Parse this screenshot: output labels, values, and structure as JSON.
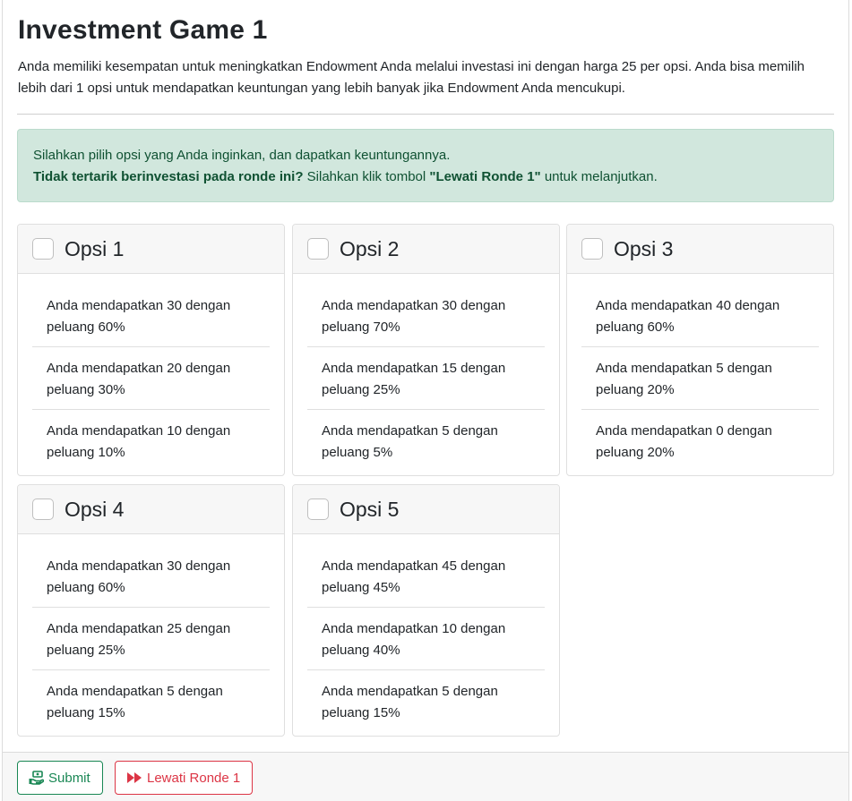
{
  "header": {
    "title": "Investment Game 1",
    "intro": "Anda memiliki kesempatan untuk meningkatkan Endowment Anda melalui investasi ini dengan harga 25 per opsi. Anda bisa memilih lebih dari 1 opsi untuk mendapatkan keuntungan yang lebih banyak jika Endowment Anda mencukupi."
  },
  "alert": {
    "line1": "Silahkan pilih opsi yang Anda inginkan, dan dapatkan keuntungannya.",
    "bold_question": "Tidak tertarik berinvestasi pada ronde ini?",
    "text_before": " Silahkan klik tombol ",
    "bold_button_ref": "\"Lewati Ronde 1\"",
    "text_after": " untuk melanjutkan."
  },
  "options": [
    {
      "title": "Opsi 1",
      "checked": false,
      "items": [
        "Anda mendapatkan 30 dengan peluang 60%",
        "Anda mendapatkan 20 dengan peluang 30%",
        "Anda mendapatkan 10 dengan peluang 10%"
      ]
    },
    {
      "title": "Opsi 2",
      "checked": false,
      "items": [
        "Anda mendapatkan 30 dengan peluang 70%",
        "Anda mendapatkan 15 dengan peluang 25%",
        "Anda mendapatkan 5 dengan peluang 5%"
      ]
    },
    {
      "title": "Opsi 3",
      "checked": false,
      "items": [
        "Anda mendapatkan 40 dengan peluang 60%",
        "Anda mendapatkan 5 dengan peluang 20%",
        "Anda mendapatkan 0 dengan peluang 20%"
      ]
    },
    {
      "title": "Opsi 4",
      "checked": false,
      "items": [
        "Anda mendapatkan 30 dengan peluang 60%",
        "Anda mendapatkan 25 dengan peluang 25%",
        "Anda mendapatkan 5 dengan peluang 15%"
      ]
    },
    {
      "title": "Opsi 5",
      "checked": false,
      "items": [
        "Anda mendapatkan 45 dengan peluang 45%",
        "Anda mendapatkan 10 dengan peluang 40%",
        "Anda mendapatkan 5 dengan peluang 15%"
      ]
    }
  ],
  "footer": {
    "submit_label": "Submit",
    "submit_icon": "hand-holding-money-icon",
    "skip_label": "Lewati Ronde 1",
    "skip_icon": "fast-forward-icon"
  },
  "colors": {
    "success": "#198754",
    "danger": "#dc3545",
    "alert_bg": "#d1e7dd",
    "alert_text": "#0f5132"
  }
}
